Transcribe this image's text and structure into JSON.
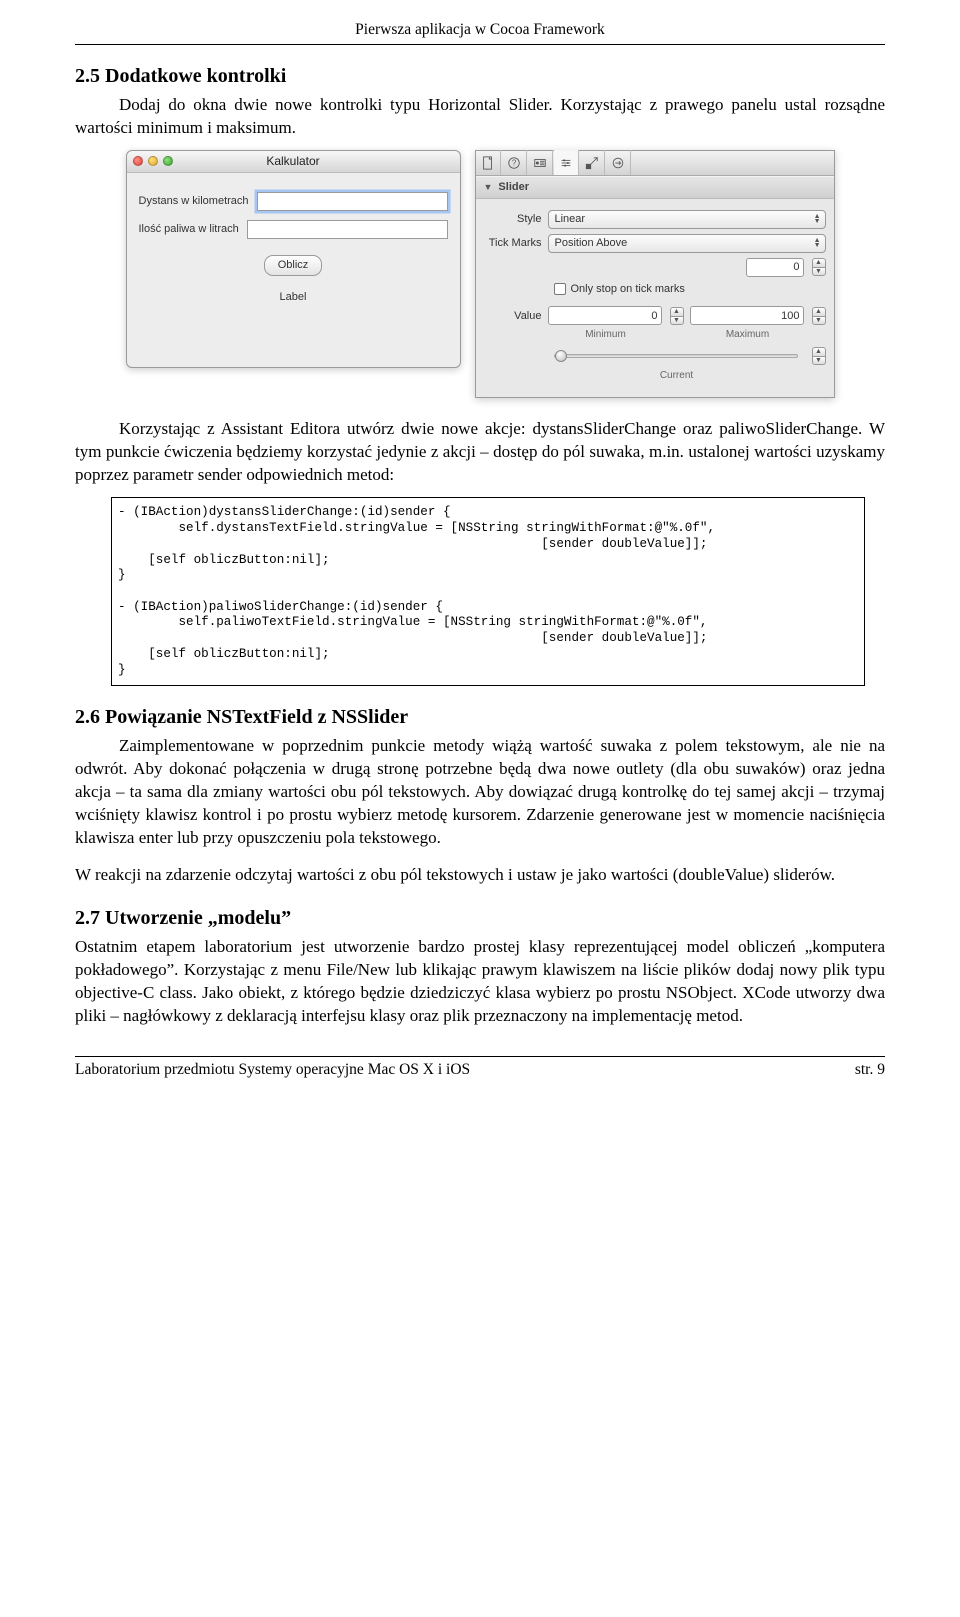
{
  "header": "Pierwsza aplikacja w Cocoa Framework",
  "s25": {
    "heading": "2.5 Dodatkowe kontrolki",
    "p1": "Dodaj do okna dwie nowe kontrolki typu Horizontal Slider. Korzystając z prawego panelu ustal rozsądne wartości minimum i maksimum.",
    "p2": "Korzystając z Assistant Editora utwórz dwie nowe akcje: dystansSliderChange oraz paliwoSliderChange. W tym punkcie ćwiczenia będziemy korzystać jedynie z akcji – dostęp do pól suwaka, m.in. ustalonej wartości uzyskamy poprzez parametr sender odpowiednich metod:"
  },
  "macwin": {
    "title": "Kalkulator",
    "label1": "Dystans w kilometrach",
    "label2": "Ilość paliwa w litrach",
    "btn": "Oblicz",
    "labelBox": "Label"
  },
  "inspector": {
    "section": "Slider",
    "style_lb": "Style",
    "style_val": "Linear",
    "tick_lb": "Tick Marks",
    "tick_val": "Position Above",
    "tick_count": "0",
    "cb_label": "Only stop on tick marks",
    "value_lb": "Value",
    "val_min": "0",
    "val_max": "100",
    "sub_min": "Minimum",
    "sub_max": "Maximum",
    "sub_cur": "Current"
  },
  "code": "- (IBAction)dystansSliderChange:(id)sender {\n        self.dystansTextField.stringValue = [NSString stringWithFormat:@\"%.0f\",\n                                                        [sender doubleValue]];\n    [self obliczButton:nil];\n}\n\n- (IBAction)paliwoSliderChange:(id)sender {\n        self.paliwoTextField.stringValue = [NSString stringWithFormat:@\"%.0f\",\n                                                        [sender doubleValue]];\n    [self obliczButton:nil];\n}",
  "s26": {
    "heading": "2.6 Powiązanie NSTextField z NSSlider",
    "p1a": "Zaimplementowane w poprzednim punkcie metody wiążą wartość suwaka z polem tekstowym, ale nie na odwrót. Aby dokonać połączenia w drugą stronę potrzebne będą dwa nowe outlety (dla obu suwaków) oraz jedna akcja – ta sama dla zmiany wartości obu pól tekstowych. Aby dowiązać drugą kontrolkę do tej samej akcji – trzymaj wciśnięty klawisz kontrol i po prostu wybierz metodę kursorem. Zdarzenie generowane jest w momencie naciśnięcia klawisza enter lub przy opuszczeniu pola tekstowego.",
    "p2": "W reakcji na zdarzenie odczytaj wartości z obu pól tekstowych i ustaw je jako wartości (doubleValue) sliderów."
  },
  "s27": {
    "heading": "2.7 Utworzenie „modelu”",
    "p1": "Ostatnim etapem laboratorium jest utworzenie bardzo prostej klasy reprezentującej model obliczeń „komputera pokładowego”. Korzystając z menu File/New lub klikając prawym klawiszem na liście plików dodaj nowy plik typu objective-C class. Jako obiekt, z którego będzie dziedziczyć klasa wybierz po prostu NSObject. XCode utworzy dwa pliki – nagłówkowy z deklaracją interfejsu klasy oraz plik przeznaczony na implementację metod."
  },
  "footer": {
    "left": "Laboratorium przedmiotu Systemy operacyjne Mac OS X i iOS",
    "right": "str. 9"
  }
}
